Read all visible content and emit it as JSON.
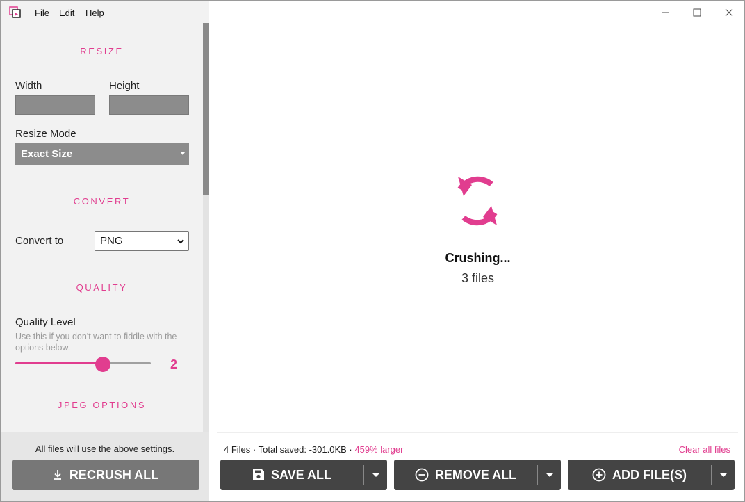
{
  "menu": {
    "items": [
      "File",
      "Edit",
      "Help"
    ]
  },
  "theme": {
    "accent": "#e13d8f",
    "button_dark": "#444444",
    "button_gray": "#777777",
    "sidebar_bg": "#f2f2f2"
  },
  "sidebar": {
    "resize": {
      "title": "RESIZE",
      "width_label": "Width",
      "width_value": "",
      "height_label": "Height",
      "height_value": "",
      "mode_label": "Resize Mode",
      "mode_value": "Exact Size"
    },
    "convert": {
      "title": "CONVERT",
      "label": "Convert to",
      "value": "PNG"
    },
    "quality": {
      "title": "QUALITY",
      "label": "Quality Level",
      "help": "Use this if you don't want to fiddle with the options below.",
      "value": "2",
      "level_fraction": 0.647
    },
    "jpeg": {
      "title": "JPEG OPTIONS"
    },
    "footer_note": "All files will use the above settings.",
    "recrush_label": "RECRUSH ALL"
  },
  "main": {
    "status_title": "Crushing...",
    "status_sub": "3 files",
    "stats_prefix": "4 Files · Total saved: -301.0KB · ",
    "stats_highlight": "459% larger",
    "clear_label": "Clear all files",
    "buttons": {
      "save": "SAVE ALL",
      "remove": "REMOVE ALL",
      "add": "ADD FILE(S)"
    }
  }
}
